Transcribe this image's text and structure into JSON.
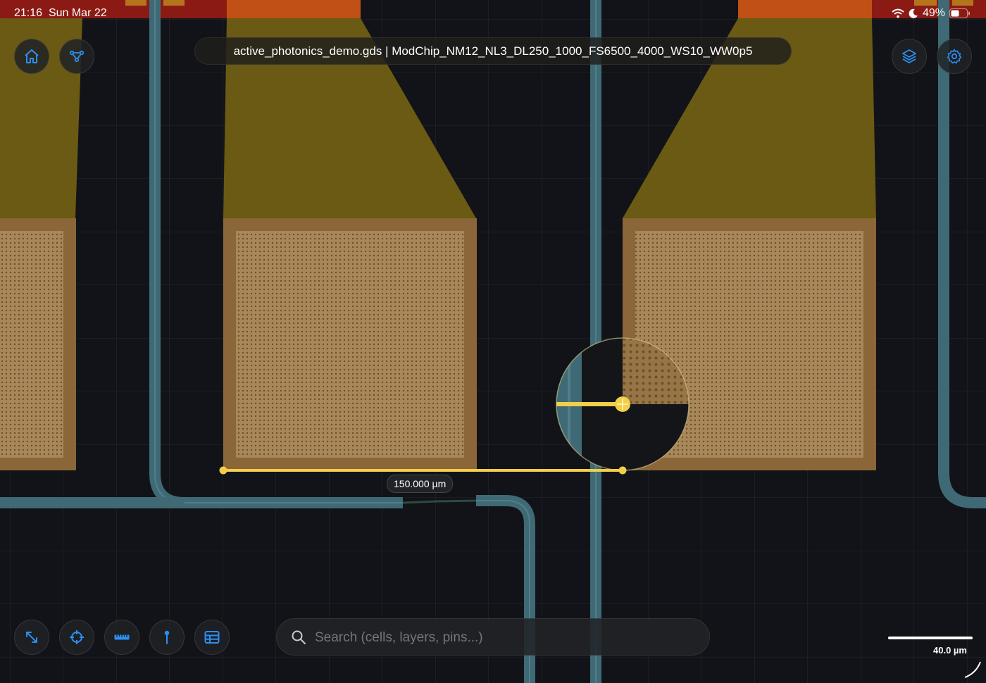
{
  "status_bar": {
    "time": "21:16",
    "date": "Sun Mar 22",
    "battery": "49%",
    "icons": [
      "wifi-icon",
      "moon-icon",
      "battery-icon"
    ]
  },
  "document": {
    "title": "active_photonics_demo.gds | ModChip_NM12_NL3_DL250_1000_FS6500_4000_WS10_WW0p5"
  },
  "top_buttons": [
    {
      "name": "home-button",
      "icon": "house-icon"
    },
    {
      "name": "hierarchy-button",
      "icon": "node-graph-icon"
    },
    {
      "name": "layers-button",
      "icon": "layers-stack-icon"
    },
    {
      "name": "settings-button",
      "icon": "gear-icon"
    }
  ],
  "bottom_tools": [
    {
      "name": "fit-view-button",
      "icon": "expand-arrows-icon"
    },
    {
      "name": "crosshair-button",
      "icon": "crosshair-icon"
    },
    {
      "name": "ruler-button",
      "icon": "ruler-icon"
    },
    {
      "name": "pin-button",
      "icon": "pin-icon"
    },
    {
      "name": "table-button",
      "icon": "table-icon"
    }
  ],
  "search": {
    "placeholder": "Search (cells, layers, pins...)",
    "value": ""
  },
  "measurement": {
    "label": "150.000 µm"
  },
  "scale": {
    "label": "40.0 µm"
  },
  "colors": {
    "accent": "#2b8ff2",
    "measure": "#f2cf4a",
    "waveguide": "#3f6a75",
    "metal_taper": "#6e5f14",
    "pad": "#8e6a3c",
    "pad_inner": "#a8875a",
    "top_layer": "#8a1a14"
  }
}
